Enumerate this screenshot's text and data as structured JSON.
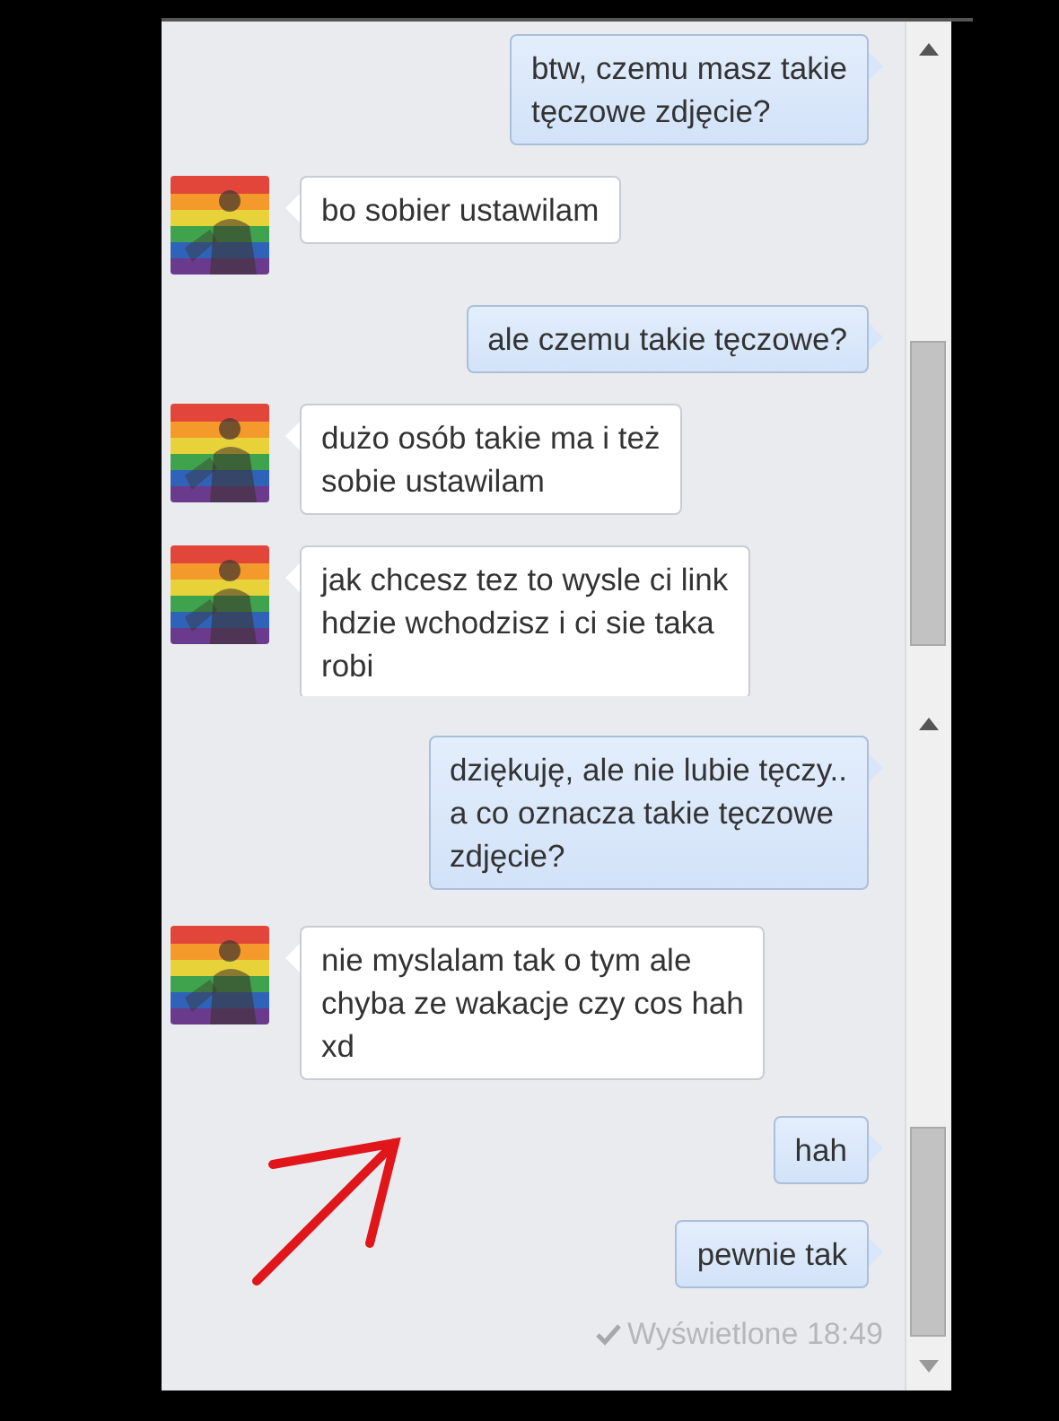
{
  "panels": [
    {
      "messages": [
        {
          "kind": "sent",
          "text": "btw, czemu masz takie\ntęczowe zdjęcie?"
        },
        {
          "kind": "received",
          "text": "bo sobier ustawilam"
        },
        {
          "kind": "sent",
          "text": "ale czemu takie tęczowe?"
        },
        {
          "kind": "received",
          "text": "dużo osób takie ma i też\nsobie ustawilam"
        },
        {
          "kind": "received",
          "text": "jak chcesz tez to wysle ci link\nhdzie wchodzisz i ci sie taka\nrobi"
        }
      ]
    },
    {
      "messages": [
        {
          "kind": "sent",
          "text": "dziękuję, ale nie lubie tęczy..\na co oznacza takie tęczowe\nzdjęcie?"
        },
        {
          "kind": "received",
          "text": "nie myslalam tak o tym ale\nchyba ze wakacje czy cos hah\nxd"
        },
        {
          "kind": "sent",
          "text": "hah"
        },
        {
          "kind": "sent",
          "text": "pewnie tak"
        }
      ],
      "seen": "Wyświetlone 18:49"
    }
  ]
}
